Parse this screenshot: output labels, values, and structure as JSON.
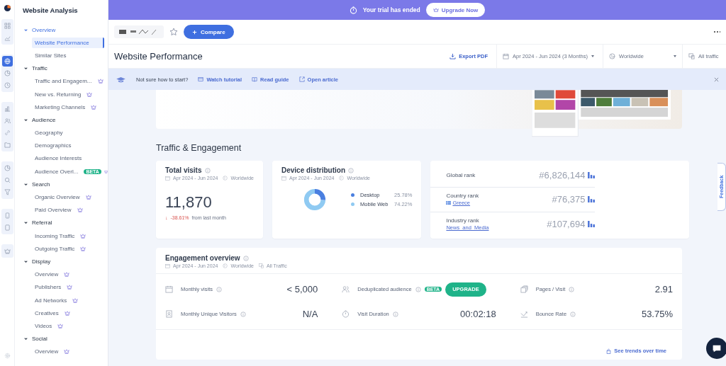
{
  "banner": {
    "text": "Your trial has ended",
    "button": "Upgrade Now"
  },
  "toolbar": {
    "starred": false,
    "compare": "Compare"
  },
  "header": {
    "title": "Website Performance",
    "export": "Export PDF",
    "date_range": "Apr 2024 - Jun 2024 (3 Months)",
    "country": "Worldwide",
    "traffic": "All traffic"
  },
  "tip_bar": {
    "question": "Not sure how to start?",
    "links": [
      {
        "kind": "video",
        "label": "Watch tutorial"
      },
      {
        "kind": "book",
        "label": "Read guide"
      },
      {
        "kind": "external",
        "label": "Open article"
      }
    ]
  },
  "rail": [
    [
      {
        "kind": "grid",
        "selected": false
      },
      {
        "kind": "trend",
        "selected": false
      }
    ],
    [
      {
        "kind": "globe",
        "selected": true
      },
      {
        "kind": "chart-pie",
        "selected": false
      },
      {
        "kind": "clock",
        "selected": false
      }
    ],
    [
      {
        "kind": "bars",
        "selected": false
      },
      {
        "kind": "people",
        "selected": false
      },
      {
        "kind": "link",
        "selected": false
      },
      {
        "kind": "folder",
        "selected": false
      }
    ],
    [
      {
        "kind": "chart-pie",
        "selected": false
      },
      {
        "kind": "search",
        "selected": false
      },
      {
        "kind": "funnel",
        "selected": false
      }
    ],
    [
      {
        "kind": "phone",
        "selected": false
      },
      {
        "kind": "tablet",
        "selected": false
      }
    ],
    [
      {
        "kind": "crown",
        "selected": false
      }
    ]
  ],
  "sidebar": {
    "title": "Website Analysis",
    "sections": [
      {
        "label": "Overview",
        "expanded": true,
        "selected": true,
        "items": [
          {
            "label": "Website Performance",
            "selected": true,
            "locked": false
          },
          {
            "label": "Similar Sites",
            "selected": false,
            "locked": false
          }
        ]
      },
      {
        "label": "Traffic",
        "expanded": true,
        "selected": false,
        "items": [
          {
            "label": "Traffic and Engagem...",
            "selected": false,
            "locked": true
          },
          {
            "label": "New vs. Returning",
            "selected": false,
            "locked": true
          },
          {
            "label": "Marketing Channels",
            "selected": false,
            "locked": true
          }
        ]
      },
      {
        "label": "Audience",
        "expanded": true,
        "selected": false,
        "items": [
          {
            "label": "Geography",
            "selected": false,
            "locked": false
          },
          {
            "label": "Demographics",
            "selected": false,
            "locked": false
          },
          {
            "label": "Audience Interests",
            "selected": false,
            "locked": false
          },
          {
            "label": "Audience Overl...",
            "selected": false,
            "locked": true,
            "badge": "BETA"
          }
        ]
      },
      {
        "label": "Search",
        "expanded": true,
        "selected": false,
        "items": [
          {
            "label": "Organic Overview",
            "selected": false,
            "locked": true
          },
          {
            "label": "Paid Overview",
            "selected": false,
            "locked": true
          }
        ]
      },
      {
        "label": "Referral",
        "expanded": true,
        "selected": false,
        "items": [
          {
            "label": "Incoming Traffic",
            "selected": false,
            "locked": true
          },
          {
            "label": "Outgoing Traffic",
            "selected": false,
            "locked": true
          }
        ]
      },
      {
        "label": "Display",
        "expanded": true,
        "selected": false,
        "items": [
          {
            "label": "Overview",
            "selected": false,
            "locked": true
          },
          {
            "label": "Publishers",
            "selected": false,
            "locked": true
          },
          {
            "label": "Ad Networks",
            "selected": false,
            "locked": true
          },
          {
            "label": "Creatives",
            "selected": false,
            "locked": true
          },
          {
            "label": "Videos",
            "selected": false,
            "locked": true
          }
        ]
      },
      {
        "label": "Social",
        "expanded": true,
        "selected": false,
        "items": [
          {
            "label": "Overview",
            "selected": false,
            "locked": true
          }
        ]
      }
    ]
  },
  "section_title": "Traffic & Engagement",
  "total_visits": {
    "title": "Total visits",
    "date": "Apr 2024 - Jun 2024",
    "region": "Worldwide",
    "value": "11,870",
    "change_arrow": "↓",
    "change": "-38.61%",
    "change_note": "from last month"
  },
  "device_distribution": {
    "title": "Device distribution",
    "date": "Apr 2024 - Jun 2024",
    "region": "Worldwide",
    "legend": [
      {
        "value": "25.78%",
        "color": "#4a7fe0"
      },
      {
        "value": "74.22%",
        "color": "#8fcaf2"
      }
    ],
    "chart_data": {
      "type": "donut",
      "categories": [
        "Desktop",
        "Mobile Web"
      ],
      "series": [
        {
          "values": [
            25.78,
            74.22
          ]
        }
      ]
    }
  },
  "ranks": [
    {
      "label": "Global rank",
      "value": "#6,826,144"
    },
    {
      "label": "Country rank",
      "value": "#76,375",
      "sub": {
        "kind": "country",
        "text": "Greece"
      }
    },
    {
      "label": "Industry rank",
      "value": "#107,694",
      "sub": {
        "kind": "category",
        "text": "News_and_Media"
      }
    }
  ],
  "engagement": {
    "title": "Engagement overview",
    "date": "Apr 2024 - Jun 2024",
    "region": "Worldwide",
    "traffic": "All Traffic",
    "metrics": [
      {
        "label": "Monthly visits",
        "kind": "value",
        "value": "< 5,000"
      },
      {
        "label": "Deduplicated audience",
        "kind": "button",
        "value": "UPGRADE",
        "badge": "BETA"
      },
      {
        "label": "Pages / Visit",
        "kind": "value",
        "value": "2.91"
      },
      {
        "label": "Monthly Unique Visitors",
        "kind": "value",
        "value": "N/A"
      },
      {
        "label": "Visit Duration",
        "kind": "value",
        "value": "00:02:18"
      },
      {
        "label": "Bounce Rate",
        "kind": "value",
        "value": "53.75%"
      }
    ],
    "footer_link": "See trends over time"
  },
  "feedback": "Feedback"
}
